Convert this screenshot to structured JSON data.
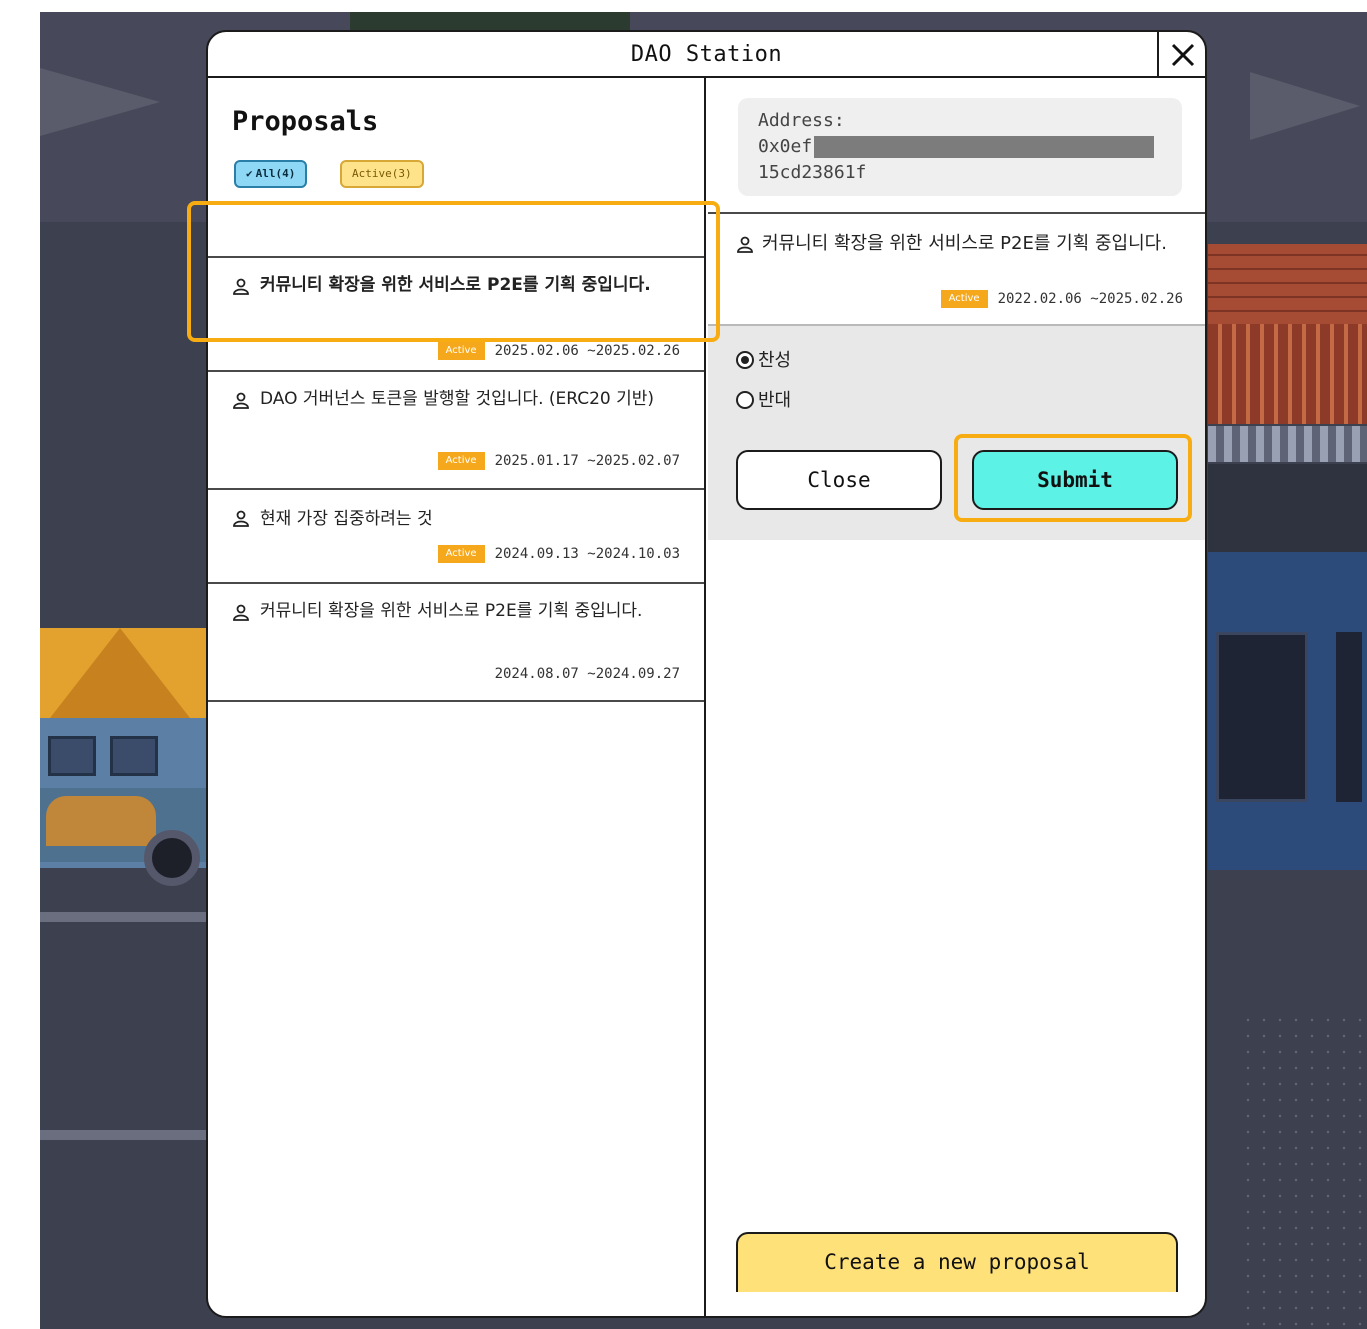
{
  "modal": {
    "title": "DAO Station",
    "close_icon": "close-x-icon"
  },
  "left": {
    "heading": "Proposals",
    "filters": [
      {
        "label": "All(4)",
        "selected": true,
        "icon": "check-icon"
      },
      {
        "label": "Active(3)",
        "selected": false
      }
    ],
    "proposals": [
      {
        "title": "커뮤니티 확장을 위한 서비스로 P2E를 기획 중입니다.",
        "status": "Active",
        "period": "2025.02.06 ~2025.02.26",
        "icon": "people-icon",
        "selected": true
      },
      {
        "title": "DAO 거버넌스 토큰을 발행할 것입니다. (ERC20 기반)",
        "status": "Active",
        "period": "2025.01.17 ~2025.02.07",
        "icon": "people-icon"
      },
      {
        "title": "현재 가장 집중하려는 것",
        "status": "Active",
        "period": "2024.09.13 ~2024.10.03",
        "icon": "people-icon"
      },
      {
        "title": "커뮤니티 확장을 위한 서비스로 P2E를 기획 중입니다.",
        "status": "",
        "period": "2024.08.07 ~2024.09.27",
        "icon": "people-icon"
      }
    ]
  },
  "right": {
    "address": {
      "label": "Address:",
      "line1_prefix": "0x0ef",
      "line2": "15cd23861f"
    },
    "detail": {
      "title": "커뮤니티 확장을 위한 서비스로 P2E를 기획 중입니다.",
      "status": "Active",
      "period": "2022.02.06 ~2025.02.26",
      "icon": "people-icon"
    },
    "vote": {
      "options": [
        {
          "label": "찬성",
          "checked": true
        },
        {
          "label": "반대",
          "checked": false
        }
      ],
      "close_label": "Close",
      "submit_label": "Submit"
    },
    "create_label": "Create a new proposal"
  },
  "colors": {
    "highlight": "#f7ad12",
    "submit_bg": "#5df2e6",
    "create_bg": "#ffe17a",
    "badge_bg": "#f6a81c",
    "chip_all_bg": "#8fd8f5",
    "chip_active_bg": "#ffe38a"
  }
}
